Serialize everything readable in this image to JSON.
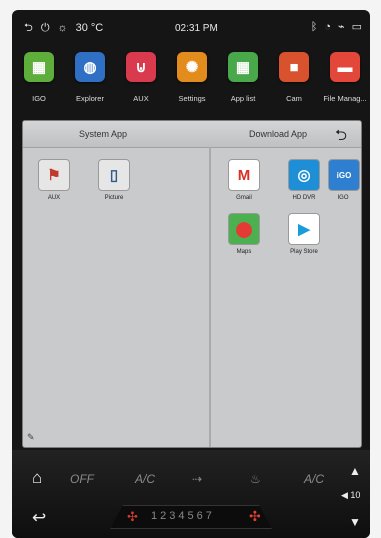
{
  "status_bar": {
    "temperature": "30 °C",
    "time": "02:31 PM"
  },
  "dock": {
    "items": [
      {
        "label": "IGO",
        "color": "#5fae3c",
        "glyph": "▦"
      },
      {
        "label": "Explorer",
        "color": "#2f6fc4",
        "glyph": "◍"
      },
      {
        "label": "AUX",
        "color": "#d93a4e",
        "glyph": "⊍"
      },
      {
        "label": "Settings",
        "color": "#e38c1e",
        "glyph": "✺"
      },
      {
        "label": "App list",
        "color": "#48a84a",
        "glyph": "▦"
      },
      {
        "label": "Cam",
        "color": "#d8522e",
        "glyph": "■"
      },
      {
        "label": "File Manag...",
        "color": "#e2473a",
        "glyph": "▬"
      }
    ]
  },
  "panel": {
    "system_header": "System App",
    "download_header": "Download App",
    "system_apps": [
      {
        "label": "AUX"
      },
      {
        "label": "Picture"
      }
    ],
    "download_apps": [
      {
        "label": "Gmail"
      },
      {
        "label": "HD DVR"
      },
      {
        "label": "IGO"
      },
      {
        "label": "Maps"
      },
      {
        "label": "Play Store"
      }
    ]
  },
  "climate": {
    "off_label": "OFF",
    "ac_label_1": "A/C",
    "ac_label_2": "A/C",
    "fan_speeds": "1234567",
    "volume_label": "◀ 10"
  }
}
